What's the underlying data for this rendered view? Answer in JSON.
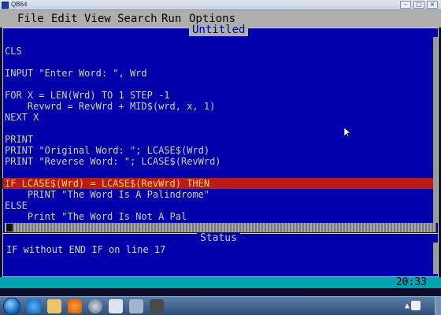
{
  "window": {
    "title": "QB64"
  },
  "menu": [
    "File",
    "Edit",
    "View",
    "Search",
    "Run",
    "Options"
  ],
  "file_title": "Untitled",
  "code_lines": [
    "CLS",
    "",
    "INPUT \"Enter Word: \", Wrd",
    "",
    "FOR X = LEN(Wrd) TO 1 STEP -1",
    "    Revwrd = RevWrd + MID$(wrd, x, 1)",
    "NEXT X",
    "",
    "PRINT",
    "PRINT \"Original Word: \"; LCASE$(Wrd)",
    "PRINT \"Reverse Word: \"; LCASE$(RevWrd)",
    "",
    "IF LCASE$(Wrd) = LCASE$(RevWrd) THEN",
    "    PRINT \"The Word Is A Palindrome\"",
    "ELSE",
    "    Print \"The Word Is Not A Pal"
  ],
  "highlight_line": 12,
  "status": {
    "title": "Status",
    "message": "IF without END IF on line 17"
  },
  "clock": "20:33",
  "colors": {
    "editor_bg": "#0000aa",
    "editor_text": "#cfcfcf",
    "error_highlight": "#bb1a1a",
    "error_text": "#ffd26a",
    "menu_bg": "#aeaeae",
    "statusbar_bg": "#00a3b0"
  }
}
